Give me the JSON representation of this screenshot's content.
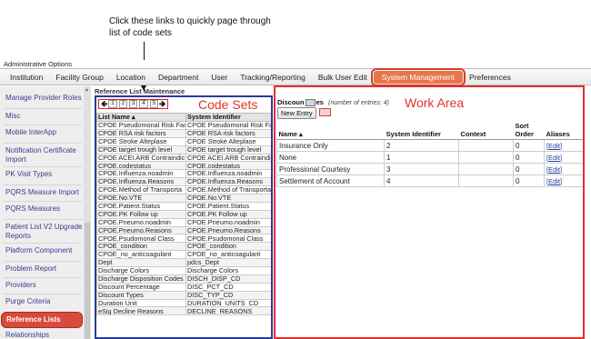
{
  "annotations": {
    "callout": "Click these links to quickly page through list of code sets",
    "code_sets_label": "Code Sets",
    "work_area_label": "Work Area"
  },
  "admin_title": "Administrative Options",
  "topnav": [
    "Institution",
    "Facility Group",
    "Location",
    "Department",
    "User",
    "Tracking/Reporting",
    "Bulk User Edit",
    "System Management",
    "Preferences"
  ],
  "topnav_active": "System Management",
  "sidebar": {
    "items": [
      "Manage Provider Roles",
      "Misc",
      "Mobile InterApp",
      "Notification Certificate Import",
      "PK Visit Types",
      "PQRS Measure Import",
      "PQRS Measures",
      "Patient List V2 Upgrade Reports",
      "Platform Component",
      "Problem Report",
      "Providers",
      "Purge Criteria",
      "Reference Lists",
      "Relationships"
    ],
    "active": "Reference Lists"
  },
  "reference_list": {
    "title": "Reference List Maintenance",
    "pager": {
      "prev_icon": "left-arrow",
      "next_icon": "right-arrow",
      "pages": [
        "1",
        "2",
        "3",
        "4",
        "5"
      ]
    },
    "columns": [
      "List Name ▴",
      "System Identifier"
    ],
    "rows": [
      [
        "CPOE Pseudomonal Risk Fac",
        "CPOE Pseudomonal Risk Fac"
      ],
      [
        "CPOE RSA risk factors",
        "CPOE RSA risk factors"
      ],
      [
        "CPOE Stroke Alteplase",
        "CPOE Stroke Alteplase"
      ],
      [
        "CPOE target trough level",
        "CPOE target trough level"
      ],
      [
        "CPOE ACEI.ARB Contraindic",
        "CPOE ACEI.ARB Contraindic"
      ],
      [
        "CPOE.codestatus",
        "CPOE.codestatus"
      ],
      [
        "CPOE.Influenza.noadmin",
        "CPOE.Influenza.noadmin"
      ],
      [
        "CPOE.Influenza.Reasons",
        "CPOE.Influenza.Reasons"
      ],
      [
        "CPOE.Method of Transporta",
        "CPOE.Method of Transporta"
      ],
      [
        "CPOE.No.VTE",
        "CPOE.No.VTE"
      ],
      [
        "CPOE.Patient.Status",
        "CPOE.Patient.Status"
      ],
      [
        "CPOE.PK Follow up",
        "CPOE.PK Follow up"
      ],
      [
        "CPOE.Pneumo.noadmin",
        "CPOE.Pneumo.noadmin"
      ],
      [
        "CPOE.Pneumo.Reasons",
        "CPOE.Pneumo.Reasons"
      ],
      [
        "CPOE.Psudomonal Class",
        "CPOE.Psudomonal Class"
      ],
      [
        "CPOE_condition",
        "CPOE_condition"
      ],
      [
        "CPOE_no_anticoagulant",
        "CPOE_no_anticoagulant"
      ],
      [
        "Dept",
        "pdcs_Dept"
      ],
      [
        "Discharge Colors",
        "Discharge Colors"
      ],
      [
        "Discharge Disposition Codes",
        "DISCH_DISP_CD"
      ],
      [
        "Discount Percentage",
        "DISC_PCT_CD"
      ],
      [
        "Discount Types",
        "DISC_TYP_CD"
      ],
      [
        "Duration Unit",
        "DURATION_UNITS_CD"
      ],
      [
        "eSig Decline Reasons",
        "DECLINE_REASONS"
      ]
    ]
  },
  "work_area": {
    "title_start": "Discoun",
    "title_end": "es",
    "entry_count": "(number of entries: 4)",
    "new_entry_label": "New Entry",
    "columns": [
      "Name ▴",
      "System Identifier",
      "Context",
      "Sort Order",
      "Aliases"
    ],
    "rows": [
      [
        "Insurance Only",
        "2",
        "",
        "0",
        "[Edit]"
      ],
      [
        "None",
        "1",
        "",
        "0",
        "[Edit]"
      ],
      [
        "Professional Courtesy",
        "3",
        "",
        "0",
        "[Edit]"
      ],
      [
        "Settlement of Account",
        "4",
        "",
        "0",
        "[Edit]"
      ]
    ]
  },
  "colors": {
    "highlight_red": "#e0332c",
    "code_sets_border": "#2a3a9c",
    "active_tab": "#e8764a",
    "active_sidebar": "#d94a3a"
  }
}
